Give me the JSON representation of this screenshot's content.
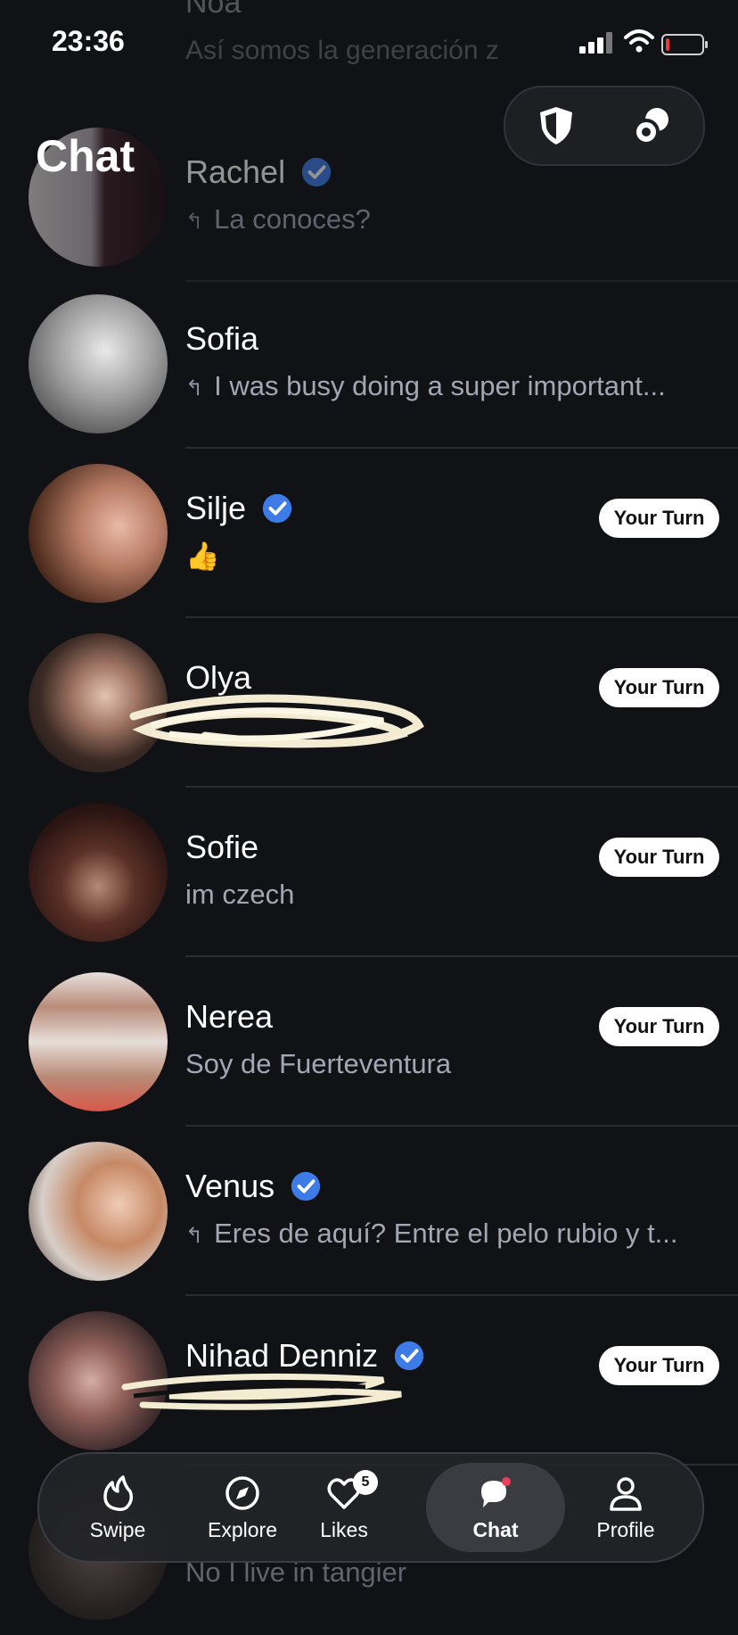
{
  "status_bar": {
    "time": "23:36"
  },
  "background_peek": {
    "name": "Noa",
    "preview": "Así somos la generación z"
  },
  "header": {
    "title": "Chat"
  },
  "chats": [
    {
      "name": "Rachel",
      "verified": true,
      "preview": "La conoces?",
      "replied": true,
      "your_turn": false,
      "faded": true
    },
    {
      "name": "Sofia",
      "verified": false,
      "preview": "I was busy doing a super important...",
      "replied": true,
      "your_turn": false
    },
    {
      "name": "Silje",
      "verified": true,
      "preview": "👍",
      "replied": false,
      "your_turn": true
    },
    {
      "name": "Olya",
      "verified": false,
      "preview": "",
      "replied": false,
      "your_turn": true
    },
    {
      "name": "Sofie",
      "verified": false,
      "preview": "im czech",
      "replied": false,
      "your_turn": true
    },
    {
      "name": "Nerea",
      "verified": false,
      "preview": "Soy de Fuerteventura",
      "replied": false,
      "your_turn": true
    },
    {
      "name": "Venus",
      "verified": true,
      "preview": "Eres de aquí? Entre el pelo rubio y t...",
      "replied": true,
      "your_turn": false
    },
    {
      "name": "Nihad Denniz",
      "verified": true,
      "preview": "",
      "replied": false,
      "your_turn": true
    },
    {
      "name": "",
      "verified": true,
      "preview": "No I live in tangier",
      "replied": false,
      "your_turn": true,
      "faded": true
    }
  ],
  "your_turn_label": "Your Turn",
  "nav": {
    "swipe": "Swipe",
    "explore": "Explore",
    "likes": "Likes",
    "likes_count": "5",
    "chat": "Chat",
    "profile": "Profile"
  },
  "colors": {
    "background": "#111215",
    "verified": "#3d7ce8",
    "badge_bg": "#ffffff",
    "notification_dot": "#e8425a"
  }
}
